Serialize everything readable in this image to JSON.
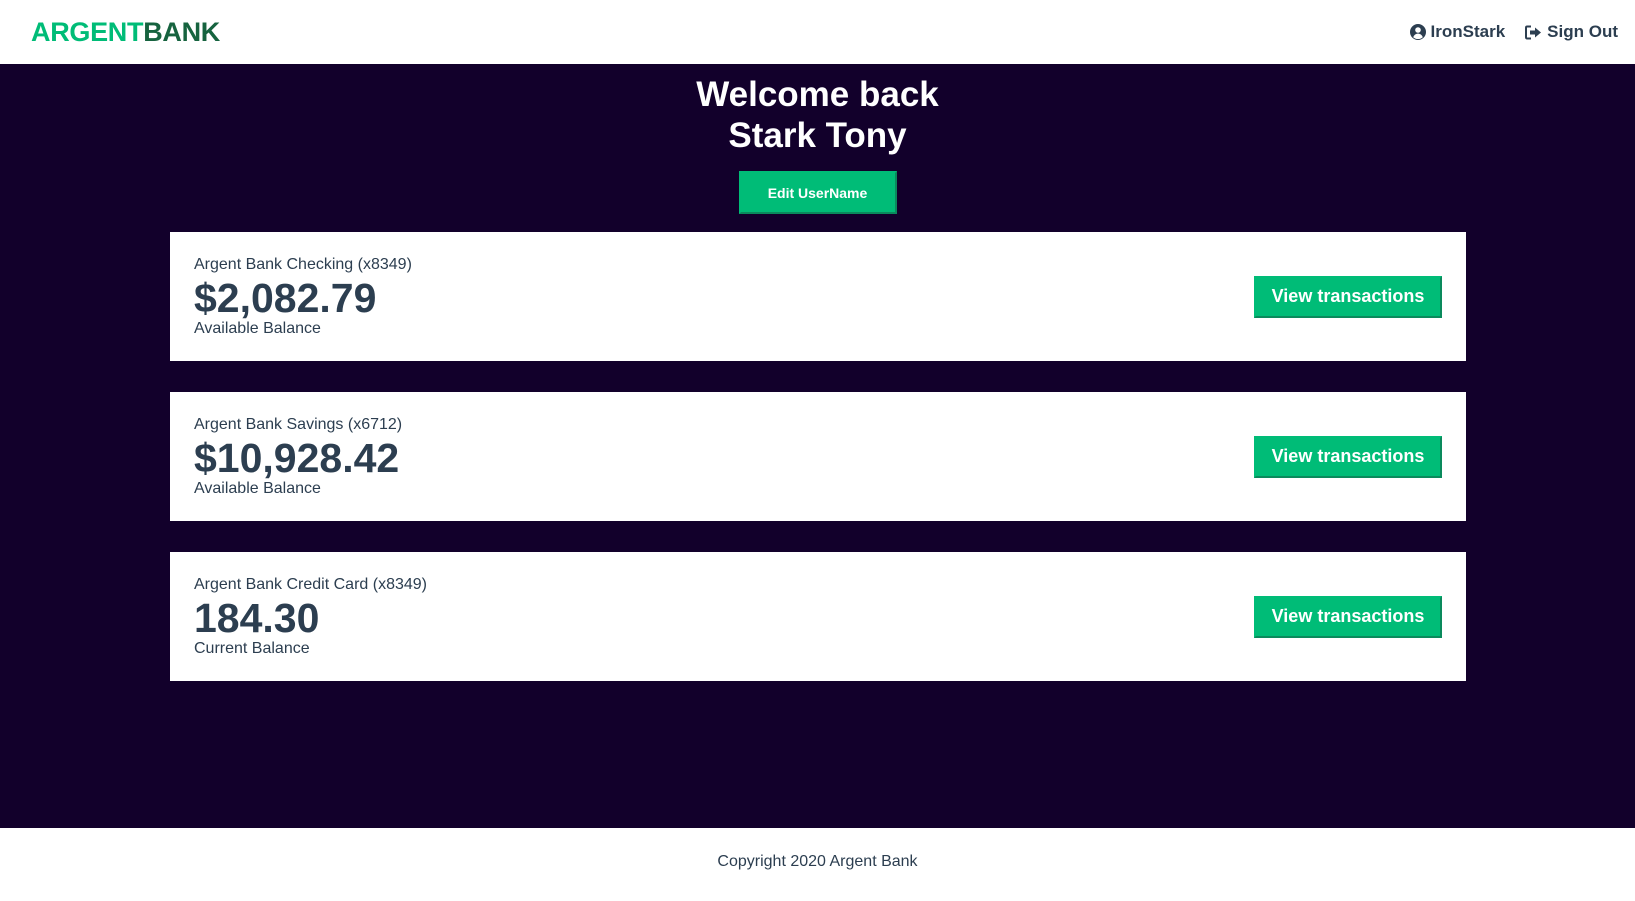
{
  "nav": {
    "logo_part1": "ARGENT",
    "logo_part2": "BANK",
    "user_name": "IronStark",
    "sign_out": "Sign Out",
    "user_icon": "user-circle-icon",
    "signout_icon": "sign-out-icon"
  },
  "header": {
    "line1": "Welcome back",
    "line2": "Stark Tony",
    "edit_label": "Edit UserName"
  },
  "accounts": [
    {
      "title": "Argent Bank Checking (x8349)",
      "amount": "$2,082.79",
      "description": "Available Balance",
      "button": "View transactions"
    },
    {
      "title": "Argent Bank Savings (x6712)",
      "amount": "$10,928.42",
      "description": "Available Balance",
      "button": "View transactions"
    },
    {
      "title": "Argent Bank Credit Card (x8349)",
      "amount": "184.30",
      "description": "Current Balance",
      "button": "View transactions"
    }
  ],
  "footer": {
    "copyright": "Copyright 2020 Argent Bank"
  },
  "colors": {
    "brand_green": "#00bc77",
    "brand_dark_green": "#16633f",
    "main_bg": "#12002b",
    "text": "#2c3e50"
  }
}
